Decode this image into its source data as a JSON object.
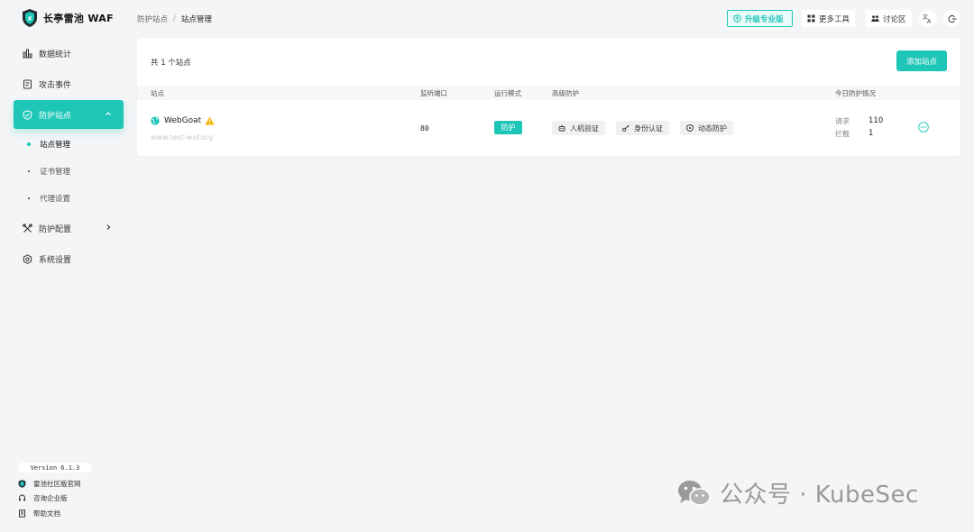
{
  "app": {
    "title": "长亭雷池 WAF"
  },
  "sidebar": {
    "items": [
      {
        "label": "数据统计",
        "icon": "bar-chart-icon"
      },
      {
        "label": "攻击事件",
        "icon": "document-icon"
      },
      {
        "label": "防护站点",
        "icon": "shield-icon",
        "active": true
      },
      {
        "label": "防护配置",
        "icon": "tools-icon"
      },
      {
        "label": "系统设置",
        "icon": "gear-icon"
      }
    ],
    "subitems": [
      {
        "label": "站点管理",
        "active": true
      },
      {
        "label": "证书管理"
      },
      {
        "label": "代理设置"
      }
    ],
    "version": "Version 6.1.3",
    "footer_links": [
      {
        "label": "雷池社区版官网",
        "icon": "shield-logo-icon"
      },
      {
        "label": "咨询企业版",
        "icon": "headset-icon"
      },
      {
        "label": "帮助文档",
        "icon": "doc-icon"
      }
    ]
  },
  "header": {
    "breadcrumb": [
      "防护站点",
      "站点管理"
    ],
    "separator": "/",
    "upgrade_label": "升级专业版",
    "more_tools_label": "更多工具",
    "forum_label": "讨论区"
  },
  "sites": {
    "count_text": "共 1 个站点",
    "add_button": "添加站点",
    "columns": [
      "站点",
      "监听端口",
      "运行模式",
      "高级防护",
      "今日防护情况"
    ],
    "rows": [
      {
        "name": "WebGoat",
        "url": "www.test-waf.org",
        "port": "80",
        "mode": "防护",
        "tags": [
          "人机验证",
          "身份认证",
          "动态防护"
        ],
        "stats": {
          "request_label": "请求",
          "request_value": "110",
          "block_label": "拦截",
          "block_value": "1"
        }
      }
    ]
  },
  "watermark": {
    "text": "公众号 · KubeSec"
  },
  "colors": {
    "accent": "#1ec6b8",
    "warning": "#f5b400"
  }
}
